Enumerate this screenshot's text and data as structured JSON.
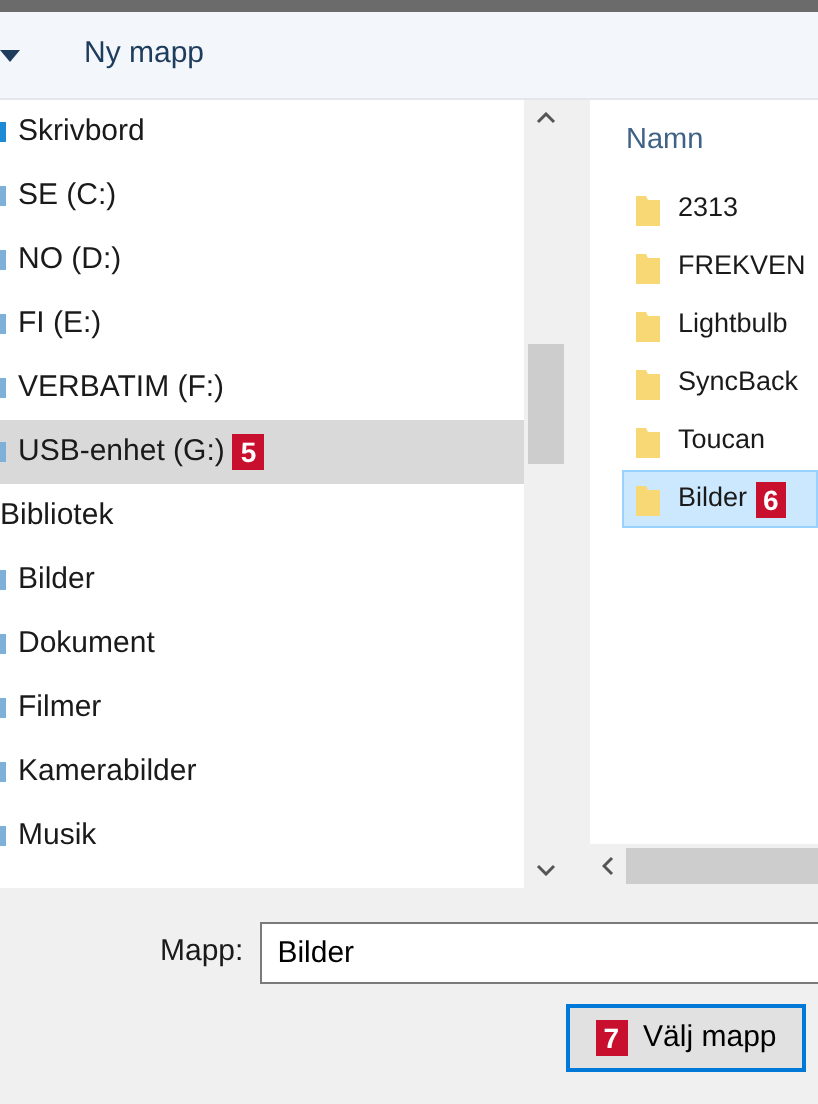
{
  "toolbar": {
    "new_folder": "Ny mapp"
  },
  "navigation": [
    {
      "label": "Skrivbord",
      "selected": false
    },
    {
      "label": "SE (C:)",
      "selected": false
    },
    {
      "label": "NO (D:)",
      "selected": false
    },
    {
      "label": "FI (E:)",
      "selected": false
    },
    {
      "label": "VERBATIM (F:)",
      "selected": false
    },
    {
      "label": "USB-enhet (G:)",
      "selected": true,
      "callout": "5"
    },
    {
      "label": "Bibliotek",
      "selected": false,
      "children": [
        {
          "label": "Bilder",
          "selected": false
        },
        {
          "label": "Dokument",
          "selected": false
        },
        {
          "label": "Filmer",
          "selected": false
        },
        {
          "label": "Kamerabilder",
          "selected": false
        },
        {
          "label": "Musik",
          "selected": false
        }
      ]
    }
  ],
  "files": {
    "column": "Namn",
    "items": [
      {
        "name": "2313",
        "selected": false
      },
      {
        "name": "FREKVEN",
        "selected": false
      },
      {
        "name": "Lightbulb",
        "selected": false
      },
      {
        "name": "SyncBack",
        "selected": false
      },
      {
        "name": "Toucan",
        "selected": false
      },
      {
        "name": "Bilder",
        "selected": true,
        "callout": "6"
      }
    ]
  },
  "folder_field": {
    "label": "Mapp:",
    "value": "Bilder"
  },
  "select_button": {
    "label": "Välj mapp",
    "callout": "7"
  }
}
